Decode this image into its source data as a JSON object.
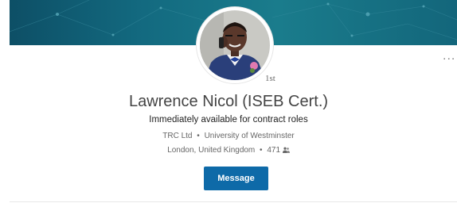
{
  "profile": {
    "name": "Lawrence Nicol (ISEB Cert.)",
    "degree": "1st",
    "headline": "Immediately available for contract roles",
    "company": "TRC Ltd",
    "separator": "•",
    "school": "University of Westminster",
    "location": "London, United Kingdom",
    "connections": "471",
    "connections_icon": "people-icon"
  },
  "actions": {
    "message_label": "Message",
    "more_label": "...",
    "more_icon": "more-icon"
  },
  "colors": {
    "banner": "#136a80",
    "button": "#0e6aa8"
  }
}
